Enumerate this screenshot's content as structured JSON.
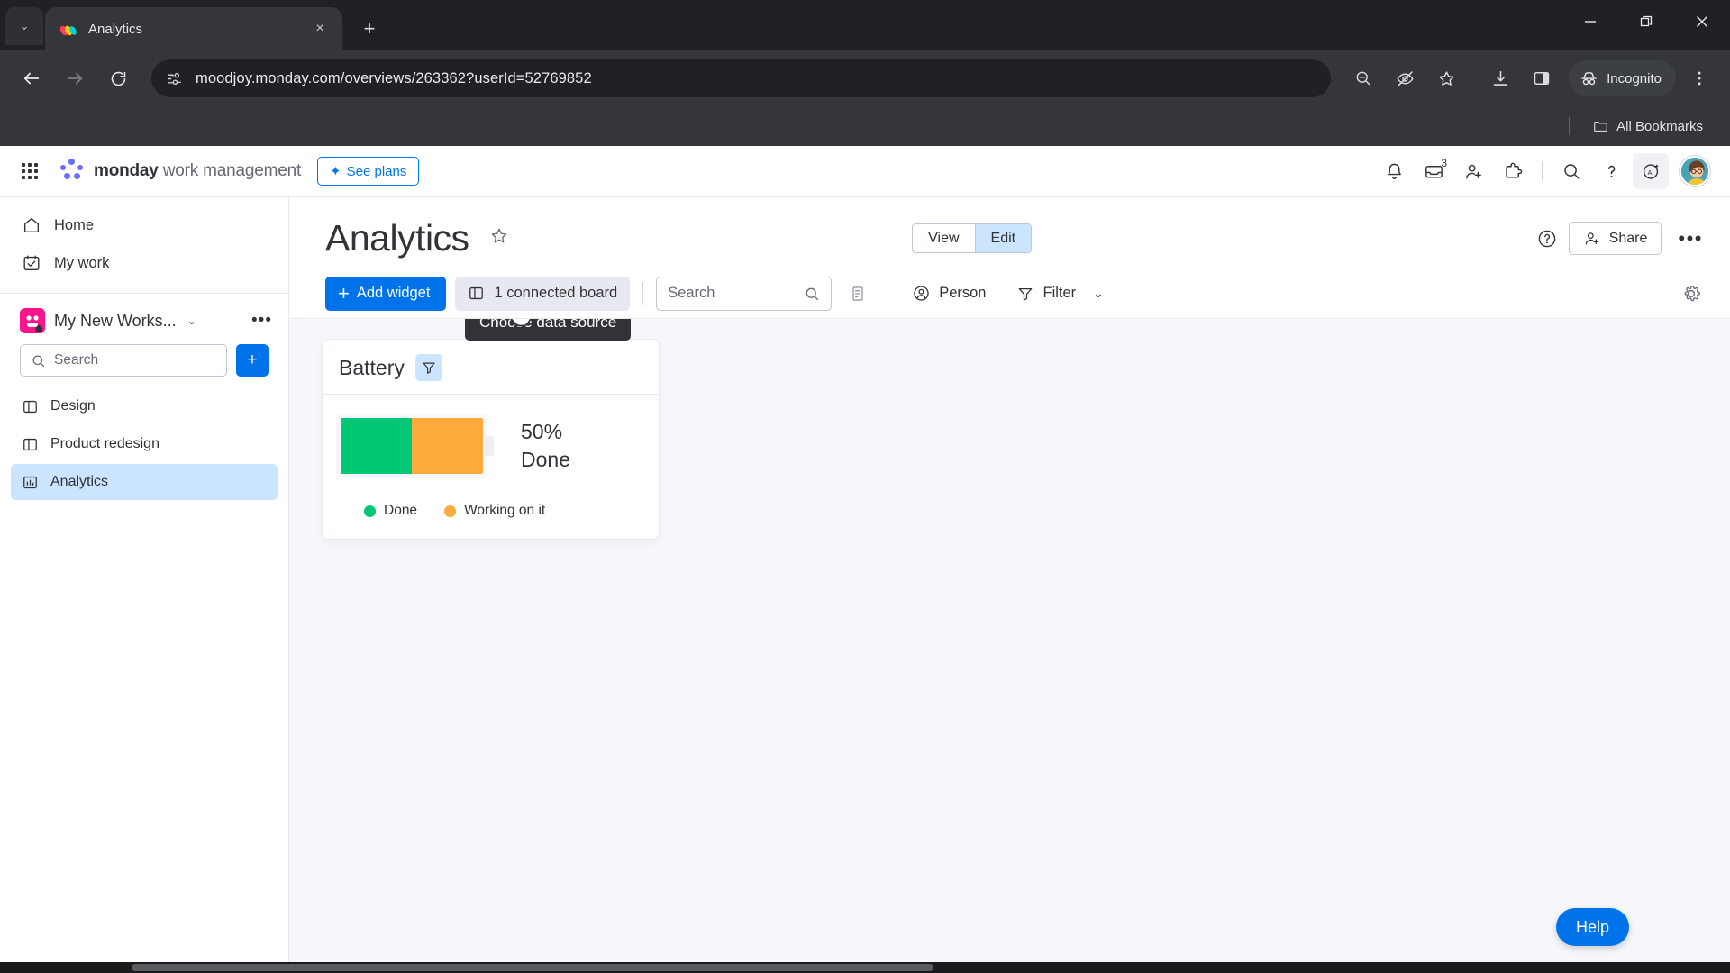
{
  "browser": {
    "tab": {
      "title": "Analytics",
      "favicon": "monday-favicon",
      "close_label": "×"
    },
    "new_tab_label": "+",
    "tab_list_chevron": "⌄",
    "window_controls": {
      "minimize": "minimize-icon",
      "maximize": "restore-icon",
      "close": "close-icon"
    },
    "nav": {
      "back": "back-arrow-icon",
      "forward": "forward-arrow-icon",
      "reload": "reload-icon"
    },
    "omnibox": {
      "url": "moodjoy.monday.com/overviews/263362?userId=52769852",
      "site_info_icon": "page-info-icon"
    },
    "toolbar_icons": [
      "zoom-out-icon",
      "eye-slash-icon",
      "bookmark-star-icon",
      "download-icon",
      "side-panel-icon"
    ],
    "profile": {
      "label": "Incognito",
      "icon": "incognito-icon"
    },
    "menu_icon": "kebab-menu-icon",
    "bookmarks": {
      "all_bookmarks_label": "All Bookmarks",
      "folder_icon": "folder-icon"
    }
  },
  "app_header": {
    "apps_icon": "apps-grid-icon",
    "brand_bold": "monday",
    "brand_light": "work management",
    "see_plans": "See plans",
    "icons": [
      {
        "name": "notifications-bell-icon",
        "badge": ""
      },
      {
        "name": "inbox-icon",
        "badge": "3"
      },
      {
        "name": "invite-member-icon",
        "badge": ""
      },
      {
        "name": "apps-marketplace-icon",
        "badge": ""
      }
    ],
    "right_icons": [
      {
        "name": "search-icon"
      },
      {
        "name": "help-question-icon"
      },
      {
        "name": "monday-ai-icon"
      }
    ],
    "avatar": "user-avatar"
  },
  "sidebar": {
    "nav": [
      {
        "label": "Home",
        "icon": "home-icon"
      },
      {
        "label": "My work",
        "icon": "my-work-calendar-icon"
      }
    ],
    "workspace": {
      "name": "My New Works...",
      "chevron": "⌄",
      "more": "•••",
      "logo": "workspace-logo"
    },
    "search": {
      "placeholder": "Search",
      "icon": "search-icon"
    },
    "add_button": "+",
    "boards": [
      {
        "label": "Design",
        "icon": "board-icon",
        "active": false
      },
      {
        "label": "Product redesign",
        "icon": "board-icon",
        "active": false
      },
      {
        "label": "Analytics",
        "icon": "dashboard-chart-icon",
        "active": true
      }
    ]
  },
  "main": {
    "title": "Analytics",
    "favorite_icon": "star-outline-icon",
    "mode_toggle": {
      "view": "View",
      "edit": "Edit",
      "selected": "Edit"
    },
    "help_icon": "help-circle-icon",
    "share": {
      "label": "Share",
      "icon": "person-add-icon"
    },
    "more_icon": "•••",
    "toolbar": {
      "add_widget": "Add widget",
      "add_widget_icon": "plus-icon",
      "connected_board": "1 connected board",
      "connected_board_icon": "board-icon",
      "search_placeholder": "Search",
      "search_icon": "search-icon",
      "notes_icon": "widget-note-icon",
      "person": "Person",
      "person_icon": "person-circle-icon",
      "filter": "Filter",
      "filter_icon": "filter-funnel-icon",
      "filter_chevron": "⌄",
      "settings_icon": "gear-icon"
    },
    "tooltip": "Choose data source",
    "cursor": "pointing-hand-cursor",
    "help_button": "Help"
  },
  "widget": {
    "title": "Battery",
    "filter_icon": "filter-funnel-icon",
    "percent": "50%",
    "state": "Done"
  },
  "chart_data": {
    "type": "bar",
    "title": "Battery",
    "orientation": "horizontal-stacked",
    "categories": [
      "Done",
      "Working on it"
    ],
    "values": [
      50,
      50
    ],
    "value_unit": "%",
    "colors": [
      "#00c875",
      "#fdab3d"
    ],
    "legend": [
      {
        "label": "Done",
        "color": "#00c875"
      },
      {
        "label": "Working on it",
        "color": "#fdab3d"
      }
    ],
    "center_label": {
      "percent": "50%",
      "state": "Done"
    },
    "legend_position": "bottom",
    "grid": false
  },
  "colors": {
    "accent_blue": "#0073ea",
    "done_green": "#00c875",
    "working_orange": "#fdab3d",
    "selected_blue": "#cce5ff",
    "text_dark": "#323338",
    "text_muted": "#676879",
    "canvas_bg": "#f6f7fb",
    "chrome_dark": "#35363a"
  }
}
